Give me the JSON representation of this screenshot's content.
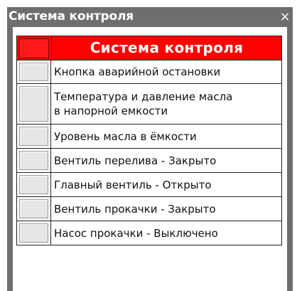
{
  "window": {
    "title": "Система контроля",
    "close_label": "×"
  },
  "header": {
    "title": "Система контроля",
    "indicator_color": "#ff0000"
  },
  "items": [
    {
      "label": "Кнопка аварийной остановки"
    },
    {
      "label": "Температура и давление масла\nв напорной емкости"
    },
    {
      "label": "Уровень масла в ёмкости"
    },
    {
      "label": "Вентиль перелива - Закрыто"
    },
    {
      "label": "Главный вентиль - Открыто"
    },
    {
      "label": "Вентиль прокачки - Закрыто"
    },
    {
      "label": "Насос прокачки - Выключено"
    }
  ],
  "colors": {
    "titlebar": "#6e6e6e",
    "header_bg": "#ff0000",
    "indicator_idle": "#e6e6e6"
  }
}
